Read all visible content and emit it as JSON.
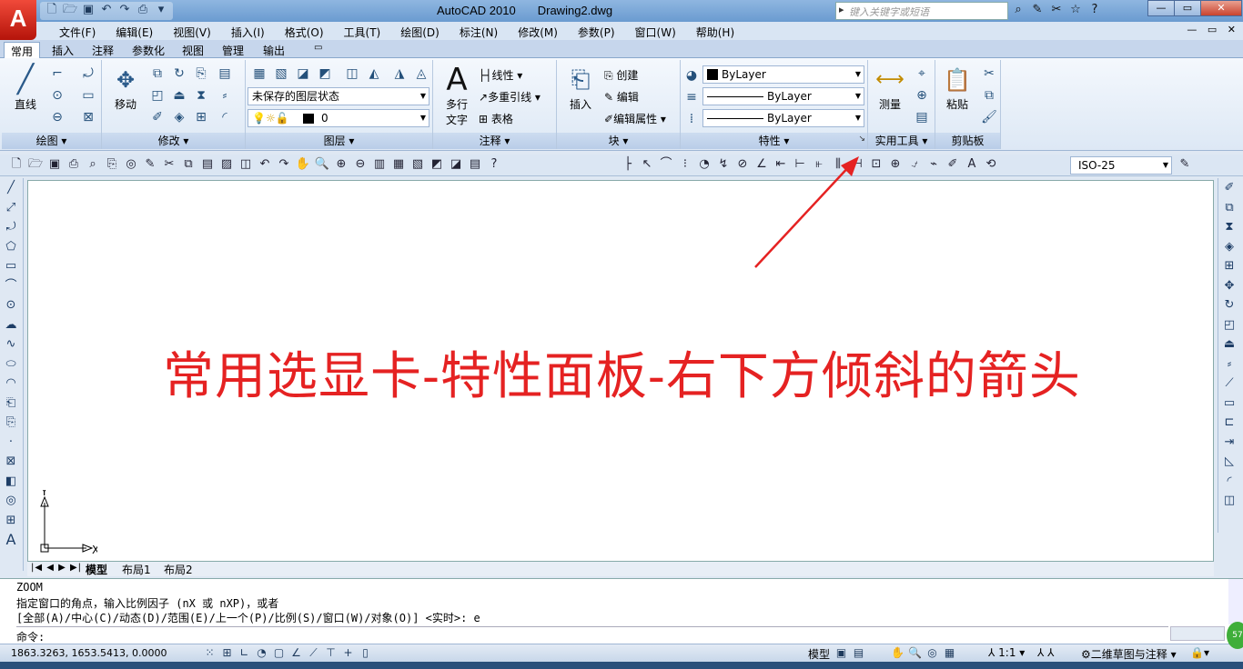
{
  "title_bar": {
    "app_name": "AutoCAD 2010",
    "doc_name": "Drawing2.dwg",
    "search_placeholder": "键入关键字或短语",
    "app_logo": "A"
  },
  "menu": [
    "文件(F)",
    "编辑(E)",
    "视图(V)",
    "插入(I)",
    "格式(O)",
    "工具(T)",
    "绘图(D)",
    "标注(N)",
    "修改(M)",
    "参数(P)",
    "窗口(W)",
    "帮助(H)"
  ],
  "ribbon_tabs": [
    "常用",
    "插入",
    "注释",
    "参数化",
    "视图",
    "管理",
    "输出"
  ],
  "panels": {
    "draw": {
      "title": "绘图 ▾",
      "line_label": "直线"
    },
    "modify": {
      "title": "修改 ▾",
      "move_label": "移动"
    },
    "layers": {
      "title": "图层 ▾",
      "state_combo": "未保存的图层状态",
      "layer_combo": "0"
    },
    "annotation": {
      "title": "注释 ▾",
      "mtext_label_1": "多行",
      "mtext_label_2": "文字",
      "linear": "线性",
      "mleader": "多重引线",
      "table": "表格"
    },
    "block": {
      "title": "块 ▾",
      "insert": "插入",
      "create": "创建",
      "edit": "编辑",
      "edit_attr": "编辑属性"
    },
    "properties": {
      "title": "特性 ▾",
      "color": "ByLayer",
      "linetype": "ByLayer",
      "lineweight": "ByLayer"
    },
    "utilities": {
      "title": "实用工具 ▾",
      "measure": "测量"
    },
    "clipboard": {
      "title": "剪贴板",
      "paste": "粘贴"
    }
  },
  "dimstyle_combo": "ISO-25",
  "canvas": {
    "annotation_text": "常用选显卡-特性面板-右下方倾斜的箭头",
    "annotation_color": "#e52222",
    "ucs_x": "X",
    "ucs_y": "Y"
  },
  "layout_tabs": [
    "模型",
    "布局1",
    "布局2"
  ],
  "command": {
    "line1": "ZOOM",
    "line2": "指定窗口的角点，输入比例因子 (nX 或 nXP)，或者",
    "line3": "[全部(A)/中心(C)/动态(D)/范围(E)/上一个(P)/比例(S)/窗口(W)/对象(O)] <实时>: e",
    "prompt": "命令:"
  },
  "status_bar": {
    "coords": "1863.3263, 1653.5413, 0.0000",
    "model": "模型",
    "scale": "1:1",
    "workspace": "二维草图与注释",
    "badge": "57"
  }
}
